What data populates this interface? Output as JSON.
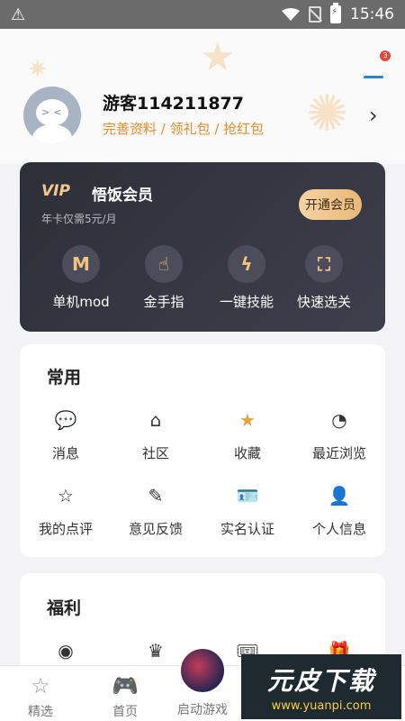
{
  "status_bar": {
    "time": "15:46",
    "warning_icon": "warning-icon"
  },
  "profile": {
    "username": "游客114211877",
    "links": "完善资料 / 领礼包 / 抢红包",
    "notification_badge": "3"
  },
  "vip": {
    "logo": "VIP",
    "title": "悟饭会员",
    "subtitle": "年卡仅需5元/月",
    "button": "开通会员",
    "features": [
      {
        "label": "单机mod",
        "icon": "m-icon"
      },
      {
        "label": "金手指",
        "icon": "golden-finger-icon"
      },
      {
        "label": "一键技能",
        "icon": "lightning-icon"
      },
      {
        "label": "快速选关",
        "icon": "level-select-icon"
      }
    ]
  },
  "common": {
    "title": "常用",
    "items": [
      {
        "label": "消息",
        "icon": "message-icon"
      },
      {
        "label": "社区",
        "icon": "home-icon"
      },
      {
        "label": "收藏",
        "icon": "star-icon"
      },
      {
        "label": "最近浏览",
        "icon": "clock-icon"
      },
      {
        "label": "我的点评",
        "icon": "review-icon"
      },
      {
        "label": "意见反馈",
        "icon": "feedback-icon"
      },
      {
        "label": "实名认证",
        "icon": "id-card-icon"
      },
      {
        "label": "个人信息",
        "icon": "user-icon"
      }
    ]
  },
  "welfare": {
    "title": "福利"
  },
  "bottom_nav": {
    "items": [
      {
        "label": "精选",
        "icon": "star-outline-icon"
      },
      {
        "label": "首页",
        "icon": "gamepad-icon"
      },
      {
        "label": "启动游戏",
        "icon": "launch-game-icon"
      }
    ]
  },
  "watermark": {
    "brand": "元皮下载",
    "url": "www.yuanpi.com"
  }
}
